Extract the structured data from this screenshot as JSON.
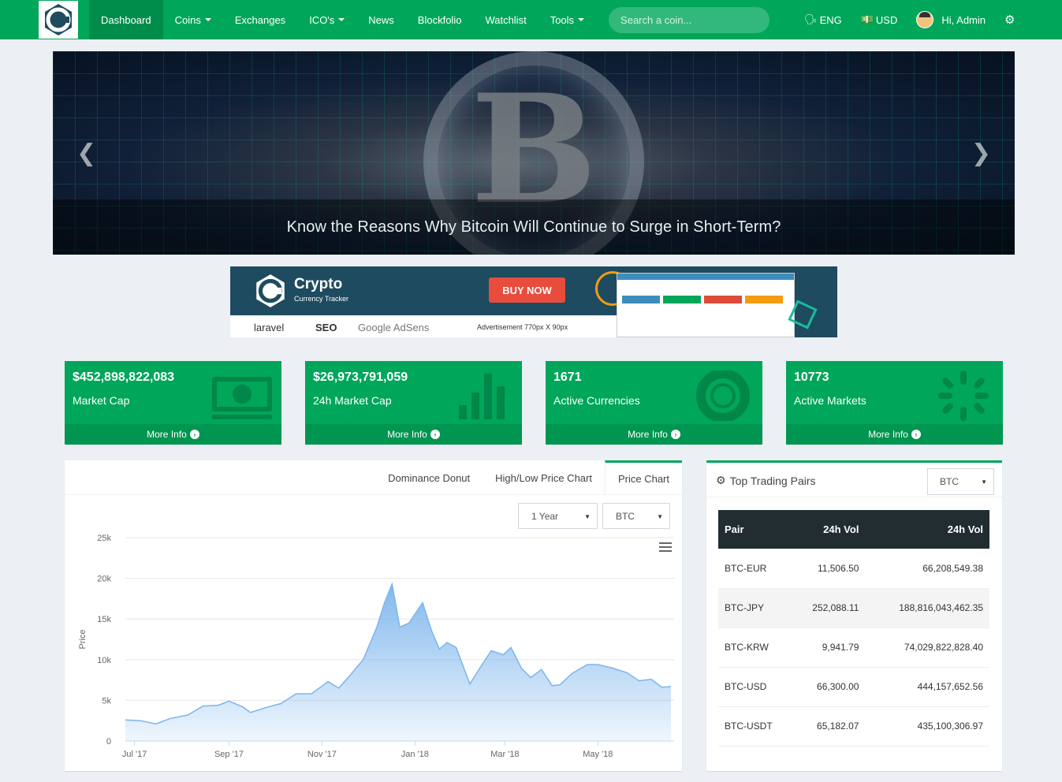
{
  "navbar": {
    "items": [
      {
        "label": "Dashboard",
        "caret": false
      },
      {
        "label": "Coins",
        "caret": true
      },
      {
        "label": "Exchanges",
        "caret": false
      },
      {
        "label": "ICO's",
        "caret": true
      },
      {
        "label": "News",
        "caret": false
      },
      {
        "label": "Blockfolio",
        "caret": false
      },
      {
        "label": "Watchlist",
        "caret": false
      },
      {
        "label": "Tools",
        "caret": true
      }
    ],
    "search_placeholder": "Search a coin...",
    "language": "ENG",
    "currency": "USD",
    "greeting": "Hi, Admin"
  },
  "banner": {
    "caption": "Know the Reasons Why Bitcoin Will Continue to Surge in Short-Term?",
    "prev_glyph": "❮",
    "next_glyph": "❯"
  },
  "ad": {
    "title": "Crypto",
    "subtitle": "Currency Tracker",
    "button": "BUY NOW",
    "tech": [
      "laravel",
      "SEO",
      "Google AdSens"
    ],
    "size_note": "Advertisement 770px X 90px"
  },
  "info_boxes": [
    {
      "value": "$452,898,822,083",
      "label": "Market Cap",
      "more": "More Info",
      "icon": "money-icon"
    },
    {
      "value": "$26,973,791,059",
      "label": "24h Market Cap",
      "more": "More Info",
      "icon": "bar-chart-icon"
    },
    {
      "value": "1671",
      "label": "Active Currencies",
      "more": "More Info",
      "icon": "life-ring-icon"
    },
    {
      "value": "10773",
      "label": "Active Markets",
      "more": "More Info",
      "icon": "spinner-icon"
    }
  ],
  "chart_panel": {
    "tabs": [
      "Dominance Donut",
      "High/Low Price Chart",
      "Price Chart"
    ],
    "active_tab": "Price Chart",
    "period": "1 Year",
    "coin": "BTC"
  },
  "chart_data": {
    "type": "area",
    "title": "",
    "xlabel": "",
    "ylabel": "Price",
    "ylim": [
      0,
      25000
    ],
    "yticks": [
      0,
      5000,
      10000,
      15000,
      20000,
      25000
    ],
    "ytick_labels": [
      "0",
      "5k",
      "10k",
      "15k",
      "20k",
      "25k"
    ],
    "xtick_labels": [
      "Jul '17",
      "Sep '17",
      "Nov '17",
      "Jan '18",
      "Mar '18",
      "May '18"
    ],
    "color": "#7cb5ec",
    "series": [
      {
        "x": [
          "2017-06-25",
          "2017-07-05",
          "2017-07-15",
          "2017-07-25",
          "2017-08-05",
          "2017-08-15",
          "2017-08-25",
          "2017-09-01",
          "2017-09-10",
          "2017-09-15",
          "2017-09-25",
          "2017-10-05",
          "2017-10-15",
          "2017-10-25",
          "2017-11-05",
          "2017-11-12",
          "2017-11-20",
          "2017-11-28",
          "2017-12-07",
          "2017-12-12",
          "2017-12-17",
          "2017-12-22",
          "2017-12-28",
          "2018-01-06",
          "2018-01-12",
          "2018-01-17",
          "2018-01-22",
          "2018-01-28",
          "2018-02-06",
          "2018-02-12",
          "2018-02-20",
          "2018-02-28",
          "2018-03-05",
          "2018-03-12",
          "2018-03-18",
          "2018-03-25",
          "2018-04-01",
          "2018-04-06",
          "2018-04-14",
          "2018-04-24",
          "2018-05-01",
          "2018-05-10",
          "2018-05-20",
          "2018-05-28",
          "2018-06-05",
          "2018-06-12",
          "2018-06-18"
        ],
        "values": [
          2600,
          2500,
          2100,
          2800,
          3200,
          4300,
          4400,
          4900,
          4200,
          3500,
          4100,
          4600,
          5800,
          5800,
          7300,
          6500,
          8200,
          10000,
          14000,
          17000,
          19300,
          14000,
          14500,
          17000,
          13500,
          11300,
          12100,
          11500,
          7000,
          8800,
          11100,
          10600,
          11500,
          8900,
          7800,
          8800,
          6800,
          6900,
          8300,
          9400,
          9400,
          9000,
          8400,
          7400,
          7600,
          6600,
          6700
        ]
      }
    ]
  },
  "pairs_panel": {
    "title": "Top Trading Pairs",
    "coin": "BTC",
    "headers": [
      "Pair",
      "24h Vol",
      "24h Vol"
    ],
    "rows": [
      [
        "BTC-EUR",
        "11,506.50",
        "66,208,549.38"
      ],
      [
        "BTC-JPY",
        "252,088.11",
        "188,816,043,462.35"
      ],
      [
        "BTC-KRW",
        "9,941.79",
        "74,029,822,828.40"
      ],
      [
        "BTC-USD",
        "66,300.00",
        "444,157,652.56"
      ],
      [
        "BTC-USDT",
        "65,182.07",
        "435,100,306.97"
      ]
    ]
  }
}
